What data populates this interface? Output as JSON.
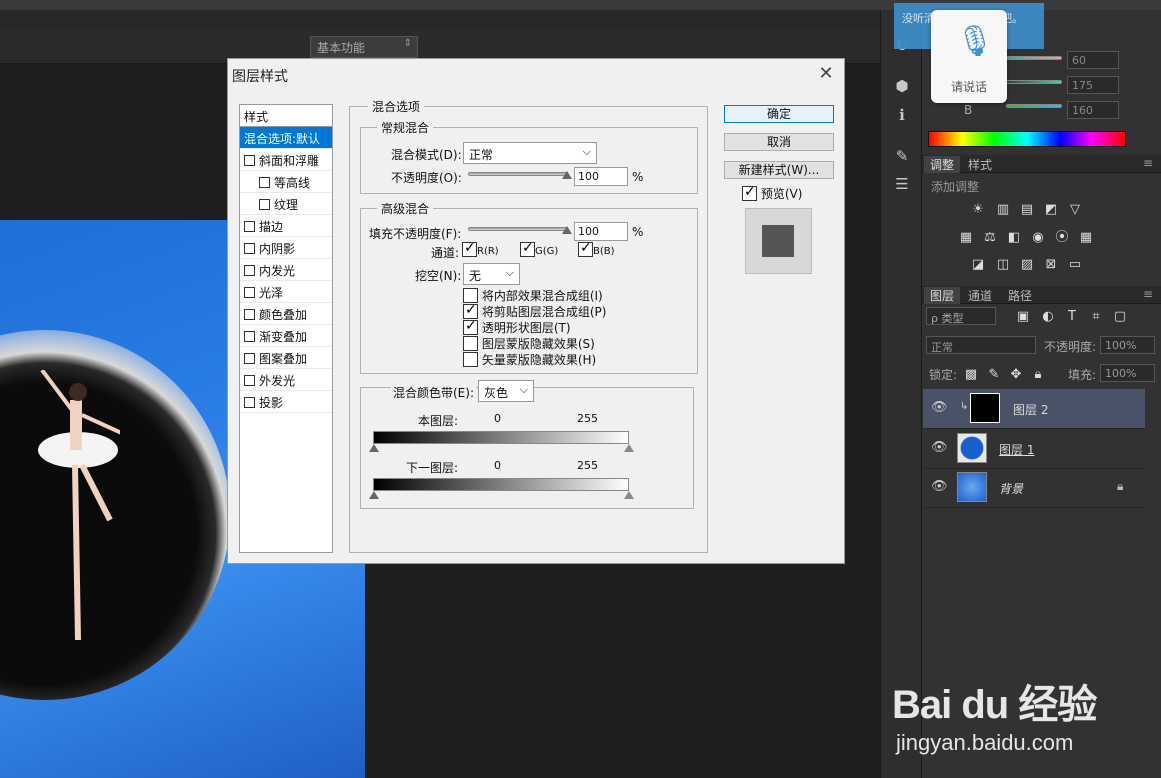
{
  "app": {
    "workspace": "基本功能"
  },
  "voice": {
    "bubble_text": "没听清，请继续说话吧。",
    "button_label": "请说话"
  },
  "color_panel": {
    "values": [
      "60",
      "175",
      "160"
    ],
    "b_label": "B"
  },
  "adjust_panel": {
    "tabs": [
      "调整",
      "样式"
    ],
    "add_label": "添加调整"
  },
  "layers_panel": {
    "tabs": [
      "图层",
      "通道",
      "路径"
    ],
    "filter_label": "ρ 类型",
    "blend_mode": "正常",
    "opacity_label": "不透明度:",
    "opacity_value": "100%",
    "lock_label": "锁定:",
    "fill_label": "填充:",
    "fill_value": "100%",
    "layers": [
      {
        "name": "图层 2",
        "selected": true
      },
      {
        "name": "图层 1",
        "selected": false
      },
      {
        "name": "背景",
        "selected": false,
        "locked": true
      }
    ]
  },
  "dialog": {
    "title": "图层样式",
    "style_list_header": "样式",
    "style_items": [
      {
        "label": "混合选项:默认",
        "selected": true,
        "checkbox": false,
        "indent": false
      },
      {
        "label": "斜面和浮雕",
        "checkbox": true,
        "indent": false
      },
      {
        "label": "等高线",
        "checkbox": true,
        "indent": true
      },
      {
        "label": "纹理",
        "checkbox": true,
        "indent": true
      },
      {
        "label": "描边",
        "checkbox": true,
        "indent": false
      },
      {
        "label": "内阴影",
        "checkbox": true,
        "indent": false
      },
      {
        "label": "内发光",
        "checkbox": true,
        "indent": false
      },
      {
        "label": "光泽",
        "checkbox": true,
        "indent": false
      },
      {
        "label": "颜色叠加",
        "checkbox": true,
        "indent": false
      },
      {
        "label": "渐变叠加",
        "checkbox": true,
        "indent": false
      },
      {
        "label": "图案叠加",
        "checkbox": true,
        "indent": false
      },
      {
        "label": "外发光",
        "checkbox": true,
        "indent": false
      },
      {
        "label": "投影",
        "checkbox": true,
        "indent": false
      }
    ],
    "blend_options_title": "混合选项",
    "general_title": "常规混合",
    "blend_mode_label": "混合模式(D):",
    "blend_mode_value": "正常",
    "opacity_label": "不透明度(O):",
    "opacity_value": "100",
    "percent": "%",
    "advanced_title": "高级混合",
    "fill_opacity_label": "填充不透明度(F):",
    "fill_opacity_value": "100",
    "channels_label": "通道:",
    "channels": [
      "R(R)",
      "G(G)",
      "B(B)"
    ],
    "knockout_label": "挖空(N):",
    "knockout_value": "无",
    "options": [
      {
        "label": "将内部效果混合成组(I)",
        "checked": false
      },
      {
        "label": "将剪贴图层混合成组(P)",
        "checked": true
      },
      {
        "label": "透明形状图层(T)",
        "checked": true
      },
      {
        "label": "图层蒙版隐藏效果(S)",
        "checked": false
      },
      {
        "label": "矢量蒙版隐藏效果(H)",
        "checked": false
      }
    ],
    "blend_if_label": "混合颜色带(E):",
    "blend_if_value": "灰色",
    "this_layer_label": "本图层:",
    "underlying_label": "下一图层:",
    "range_low": "0",
    "range_high": "255",
    "ok_label": "确定",
    "cancel_label": "取消",
    "new_style_label": "新建样式(W)...",
    "preview_label": "预览(V)"
  },
  "watermark": {
    "logo": "Bai du 经验",
    "url": "jingyan.baidu.com"
  }
}
